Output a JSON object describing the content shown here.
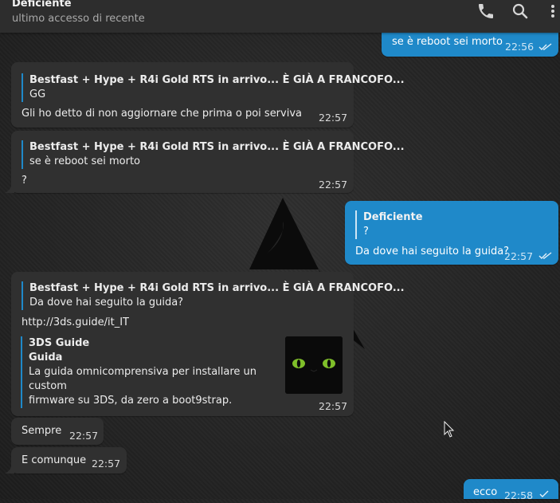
{
  "header": {
    "title": "Deficiente",
    "status": "ultimo accesso di recente",
    "icons": [
      "phone-icon",
      "search-icon",
      "more-vertical-icon"
    ]
  },
  "messages": {
    "m1": {
      "text": "se è reboot sei morto",
      "time": "22:56"
    },
    "m2": {
      "reply_title": "Bestfast + Hype + R4i Gold RTS in arrivo... È GIÀ A FRANCOFO...",
      "reply_text": "GG",
      "text": "Gli ho detto di non aggiornare che prima o poi serviva",
      "time": "22:57"
    },
    "m3": {
      "reply_title": "Bestfast + Hype + R4i Gold RTS in arrivo... È GIÀ A FRANCOFO...",
      "reply_text": "se è reboot sei morto",
      "text": "?",
      "time": "22:57"
    },
    "m4": {
      "reply_title": "Deficiente",
      "reply_text": "?",
      "text": "Da dove hai seguito la guida?",
      "time": "22:57"
    },
    "m5": {
      "reply_title": "Bestfast + Hype + R4i Gold RTS in arrivo... È GIÀ A FRANCOFO...",
      "reply_text": "Da dove hai seguito la guida?",
      "link": "http://3ds.guide/it_IT",
      "preview_site": "3DS Guide",
      "preview_title": "Guida",
      "preview_desc_1": "La guida omnicomprensiva per installare un custom",
      "preview_desc_2": "firmware su 3DS,  da zero a boot9strap.",
      "time": "22:57"
    },
    "m6": {
      "text": "Sempre",
      "time": "22:57"
    },
    "m7": {
      "text": "E comunque",
      "time": "22:57"
    },
    "m8": {
      "text": "ecco",
      "time": "22:58"
    }
  },
  "colors": {
    "outgoing_bubble": "#1f89c9",
    "incoming_bubble": "#303030",
    "header_bg": "#2d2d2d"
  }
}
